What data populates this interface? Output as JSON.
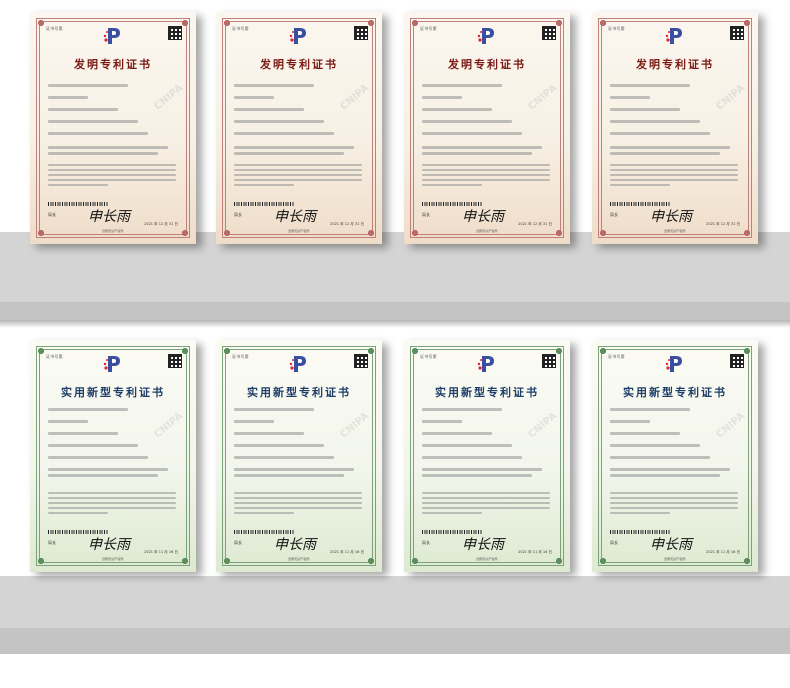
{
  "rows": [
    {
      "type": "invention",
      "certs": [
        {
          "title": "发明专利证书",
          "date": "2021 年 12 月 31 日"
        },
        {
          "title": "发明专利证书",
          "date": "2021 年 12 月 31 日"
        },
        {
          "title": "发明专利证书",
          "date": "2021 年 12 月 31 日"
        },
        {
          "title": "发明专利证书",
          "date": "2021 年 12 月 31 日"
        }
      ]
    },
    {
      "type": "utility",
      "certs": [
        {
          "title": "实用新型专利证书",
          "date": "2021 年 11 月 16 日"
        },
        {
          "title": "实用新型专利证书",
          "date": "2021 年 11 月 16 日"
        },
        {
          "title": "实用新型专利证书",
          "date": "2021 年 11 月 16 日"
        },
        {
          "title": "实用新型专利证书",
          "date": "2021 年 11 月 16 日"
        }
      ]
    }
  ],
  "common": {
    "cert_no_label": "证书号第",
    "director_label": "局长",
    "director_name": "申长雨",
    "signature": "申长雨",
    "footer": "国家知识产权局",
    "watermark": "CNIPA"
  },
  "colors": {
    "invention_border": "#c07f7a",
    "utility_border": "#7aa37a",
    "shelf": "#d4d4d4"
  }
}
